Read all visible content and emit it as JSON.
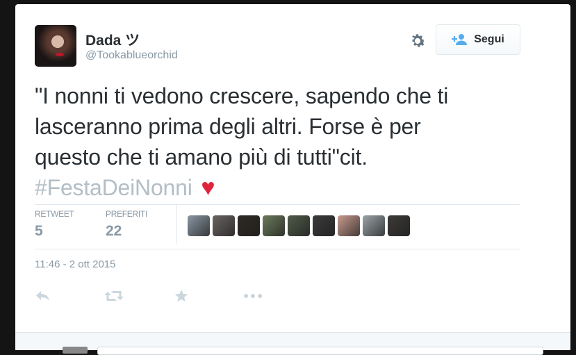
{
  "tweet": {
    "author_name": "Dada ツ",
    "author_handle": "@Tookablueorchid",
    "text_line1": "\"I nonni ti vedono crescere, sapendo che ti",
    "text_line2": "lasceranno prima degli altri. Forse è per",
    "text_line3": "questo che ti amano più di tutti\"cit.",
    "hashtag": "#FestaDeiNonni",
    "emoji": "♥",
    "timestamp": "11:46 - 2 ott 2015"
  },
  "follow_button": {
    "label": "Segui",
    "icon": "add-user-icon"
  },
  "stats": {
    "retweet_label": "RETWEET",
    "retweet_count": "5",
    "favorites_label": "PREFERITI",
    "favorites_count": "22"
  },
  "favoriters": [
    {
      "name": "favoriter-avatar",
      "color": "#8a96a3"
    },
    {
      "name": "favoriter-avatar",
      "color": "#6a6462"
    },
    {
      "name": "favoriter-avatar",
      "color": "#2e2a24"
    },
    {
      "name": "favoriter-avatar",
      "color": "#6b7a5a"
    },
    {
      "name": "favoriter-avatar",
      "color": "#4f5a48"
    },
    {
      "name": "favoriter-avatar",
      "color": "#3a3a3a"
    },
    {
      "name": "favoriter-avatar",
      "color": "#c89a8e"
    },
    {
      "name": "favoriter-avatar",
      "color": "#9aa4a8"
    },
    {
      "name": "favoriter-avatar",
      "color": "#3c3a38"
    }
  ],
  "actions": [
    "reply-icon",
    "retweet-icon",
    "favorite-icon",
    "more-icon"
  ],
  "colors": {
    "text": "#292f33",
    "muted": "#8899a6",
    "hashtag": "#b3bec6",
    "heart": "#e0243a",
    "follow_icon": "#55acee"
  }
}
